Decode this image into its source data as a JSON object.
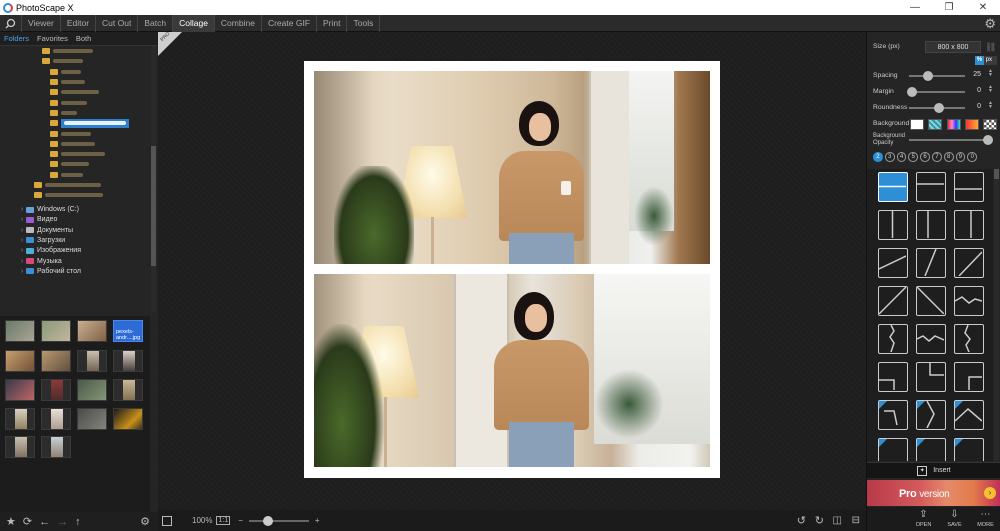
{
  "app": {
    "title": "PhotoScape X",
    "window_controls": [
      "—",
      "❐",
      "✕"
    ]
  },
  "menu": {
    "tabs": [
      "Viewer",
      "Editor",
      "Cut Out",
      "Batch",
      "Collage",
      "Combine",
      "Create GIF",
      "Print",
      "Tools"
    ],
    "active": "Collage"
  },
  "left": {
    "tabs": [
      "Folders",
      "Favorites",
      "Both"
    ],
    "tree": [
      {
        "label": "Windows (C:)",
        "icon": "drive-icon"
      },
      {
        "label": "Видео",
        "icon": "video-folder-icon"
      },
      {
        "label": "Документы",
        "icon": "documents-folder-icon"
      },
      {
        "label": "Загрузки",
        "icon": "downloads-folder-icon"
      },
      {
        "label": "Изображения",
        "icon": "pictures-folder-icon"
      },
      {
        "label": "Музыка",
        "icon": "music-folder-icon"
      },
      {
        "label": "Рабочий стол",
        "icon": "desktop-folder-icon"
      }
    ],
    "selected_thumb_caption": "pexels-andr....jpg",
    "bottom_icons": [
      "star-icon",
      "refresh-icon",
      "back-arrow-icon",
      "forward-arrow-icon",
      "up-arrow-icon",
      "gear-icon"
    ]
  },
  "center": {
    "pro_badge": "PRO",
    "zoom": "100%",
    "ratio_btn": "1:1",
    "zoom_minus": "−",
    "zoom_plus": "+",
    "bottom_icons": [
      "rotate-left-icon",
      "rotate-right-icon",
      "flip-horizontal-icon",
      "flip-vertical-icon"
    ]
  },
  "right": {
    "size_label": "Size (px)",
    "size_value": "800 x 800",
    "px_label": "px",
    "percent_label": "%",
    "spacing": {
      "label": "Spacing",
      "value": "25"
    },
    "margin": {
      "label": "Margin",
      "value": "0"
    },
    "roundness": {
      "label": "Roundness",
      "value": "0"
    },
    "background_label": "Background",
    "opacity_label_1": "Background",
    "opacity_label_2": "Opacity",
    "photo_counts": [
      "2",
      "3",
      "4",
      "5",
      "6",
      "7",
      "8",
      "9",
      "0"
    ],
    "active_count": "2",
    "insert_label": "Insert",
    "promo_small": "Pro",
    "promo_text": "version",
    "bottom": [
      {
        "icon": "open-icon",
        "label": "OPEN"
      },
      {
        "icon": "save-icon",
        "label": "SAVE"
      },
      {
        "icon": "more-icon",
        "label": "MORE"
      }
    ],
    "colors": {
      "accent": "#2d8fd5"
    }
  }
}
